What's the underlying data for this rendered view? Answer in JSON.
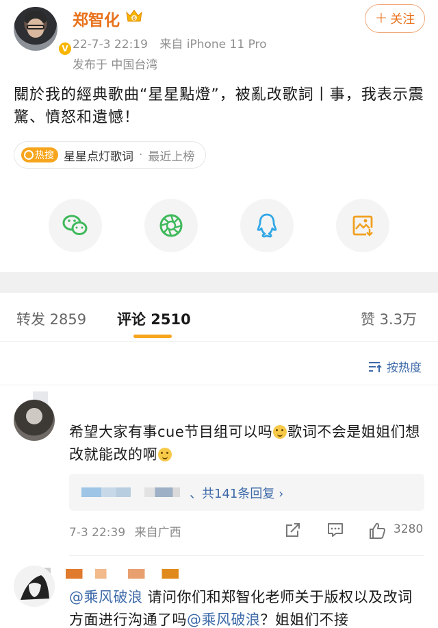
{
  "post": {
    "author": "郑智化",
    "date": "22-7-3 22:19",
    "source": "来自 iPhone 11 Pro",
    "location": "发布于 中国台湾",
    "follow_label": "关注",
    "text": "關於我的經典歌曲“星星點燈”，被亂改歌詞丨事，我表示震驚、憤怒和遺憾！",
    "hot_tag": {
      "badge": "热搜",
      "topic": "星星点灯歌词",
      "separator": "·",
      "rank": "最近上榜"
    },
    "share_targets": [
      "wechat-icon",
      "moments-icon",
      "qq-icon",
      "save-image-icon"
    ]
  },
  "tabs": {
    "repost": "转发 2859",
    "comments": "评论 2510",
    "likes": "赞 3.3万"
  },
  "sort_label": "按热度",
  "comments": [
    {
      "text_part1": "希望大家有事cue节目组可以吗",
      "text_part2": "歌词不会是姐姐们想改就能改的啊",
      "replies": "、共141条回复 ›",
      "time": "7-3 22:39",
      "source": "来自广西",
      "likes": "3280"
    },
    {
      "mention1": "@乘风破浪",
      "text_part1": " 请问你们和郑智化老师关于版权以及改词方面进行沟通了吗",
      "mention2": "@乘风破浪",
      "text_part2": "？姐姐们不接"
    }
  ],
  "colors": {
    "accent": "#e8721c",
    "link": "#3d6aa8",
    "hot": "#f7a51c",
    "wechat": "#3fb95b",
    "qq": "#31a7e6"
  }
}
